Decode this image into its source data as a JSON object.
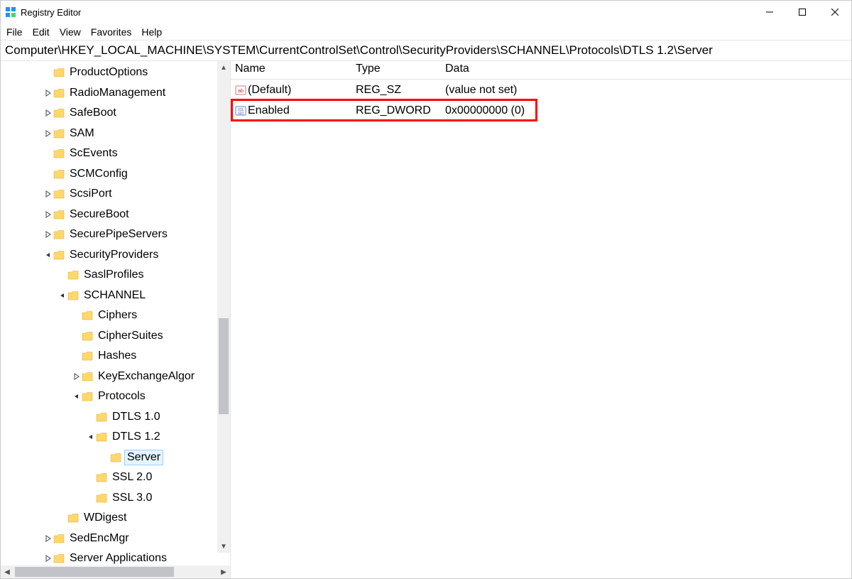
{
  "app_title": "Registry Editor",
  "menubar": {
    "file": "File",
    "edit": "Edit",
    "view": "View",
    "favorites": "Favorites",
    "help": "Help"
  },
  "address_path": "Computer\\HKEY_LOCAL_MACHINE\\SYSTEM\\CurrentControlSet\\Control\\SecurityProviders\\SCHANNEL\\Protocols\\DTLS 1.2\\Server",
  "tree": {
    "items": [
      {
        "indent": 2,
        "chev": "none",
        "label": "ProductOptions"
      },
      {
        "indent": 2,
        "chev": "closed",
        "label": "RadioManagement"
      },
      {
        "indent": 2,
        "chev": "closed",
        "label": "SafeBoot"
      },
      {
        "indent": 2,
        "chev": "closed",
        "label": "SAM"
      },
      {
        "indent": 2,
        "chev": "none",
        "label": "ScEvents"
      },
      {
        "indent": 2,
        "chev": "none",
        "label": "SCMConfig"
      },
      {
        "indent": 2,
        "chev": "closed",
        "label": "ScsiPort"
      },
      {
        "indent": 2,
        "chev": "closed",
        "label": "SecureBoot"
      },
      {
        "indent": 2,
        "chev": "closed",
        "label": "SecurePipeServers"
      },
      {
        "indent": 2,
        "chev": "open",
        "label": "SecurityProviders"
      },
      {
        "indent": 3,
        "chev": "none",
        "label": "SaslProfiles"
      },
      {
        "indent": 3,
        "chev": "open",
        "label": "SCHANNEL"
      },
      {
        "indent": 4,
        "chev": "none",
        "label": "Ciphers"
      },
      {
        "indent": 4,
        "chev": "none",
        "label": "CipherSuites"
      },
      {
        "indent": 4,
        "chev": "none",
        "label": "Hashes"
      },
      {
        "indent": 4,
        "chev": "closed",
        "label": "KeyExchangeAlgor"
      },
      {
        "indent": 4,
        "chev": "open",
        "label": "Protocols"
      },
      {
        "indent": 5,
        "chev": "none",
        "label": "DTLS 1.0"
      },
      {
        "indent": 5,
        "chev": "open",
        "label": "DTLS 1.2"
      },
      {
        "indent": 6,
        "chev": "none",
        "label": "Server",
        "selected": true
      },
      {
        "indent": 5,
        "chev": "none",
        "label": "SSL 2.0"
      },
      {
        "indent": 5,
        "chev": "none",
        "label": "SSL 3.0"
      },
      {
        "indent": 3,
        "chev": "none",
        "label": "WDigest"
      },
      {
        "indent": 2,
        "chev": "closed",
        "label": "SedEncMgr"
      },
      {
        "indent": 2,
        "chev": "closed",
        "label": "Server Applications"
      }
    ]
  },
  "list": {
    "columns": {
      "name": "Name",
      "type": "Type",
      "data": "Data"
    },
    "rows": [
      {
        "icon": "sz",
        "name": "(Default)",
        "type": "REG_SZ",
        "data": "(value not set)"
      },
      {
        "icon": "dw",
        "name": "Enabled",
        "type": "REG_DWORD",
        "data": "0x00000000 (0)",
        "highlighted": true
      }
    ]
  }
}
